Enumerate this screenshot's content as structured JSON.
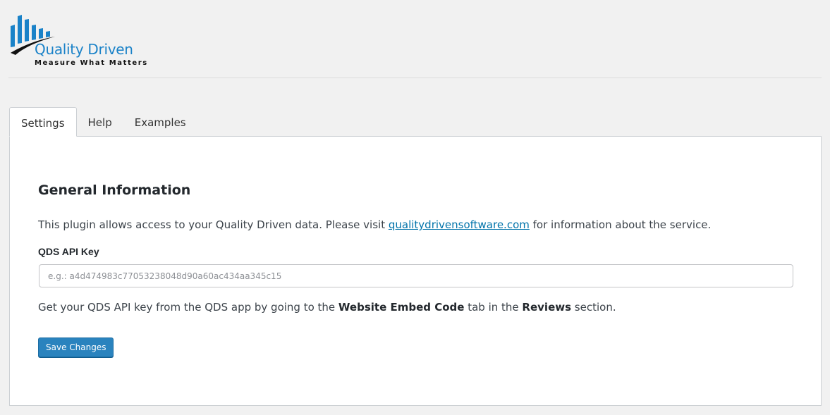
{
  "logo": {
    "name": "Quality Driven",
    "tagline": "Measure What Matters",
    "brand_color": "#1a82c8",
    "icon": "bar-chart-swoosh-icon"
  },
  "tabs": [
    {
      "label": "Settings",
      "active": true
    },
    {
      "label": "Help",
      "active": false
    },
    {
      "label": "Examples",
      "active": false
    }
  ],
  "settings": {
    "section_title": "General Information",
    "description_prefix": "This plugin allows access to your Quality Driven data. Please visit ",
    "description_link": "qualitydrivensoftware.com",
    "description_suffix": " for information about the service.",
    "api_key_label": "QDS API Key",
    "api_key_placeholder": "e.g.: a4d474983c77053238048d90a60ac434aa345c15",
    "api_key_value": "",
    "help_prefix": "Get your QDS API key from the QDS app by going to the ",
    "help_bold_1": "Website Embed Code",
    "help_middle": " tab in the ",
    "help_bold_2": "Reviews",
    "help_suffix": " section.",
    "save_label": "Save Changes"
  },
  "colors": {
    "accent": "#2a83be",
    "link": "#0073aa"
  }
}
